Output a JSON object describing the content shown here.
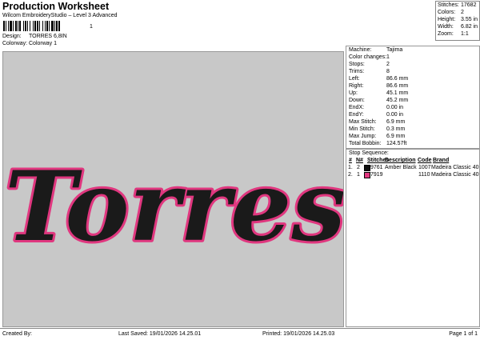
{
  "header": {
    "title": "Production Worksheet",
    "subtitle": "Wilcom EmbroideryStudio – Level 3 Advanced",
    "barcode_num": "1"
  },
  "meta": [
    {
      "key": "Design:",
      "value": "TORRES 6,8IN"
    },
    {
      "key": "Colorway:",
      "value": "Colorway 1"
    }
  ],
  "stats": [
    {
      "key": "Stitches:",
      "value": "17682"
    },
    {
      "key": "Colors:",
      "value": "2"
    },
    {
      "key": "Height:",
      "value": "3.55 in"
    },
    {
      "key": "Width:",
      "value": "6.82 in"
    },
    {
      "key": "Zoom:",
      "value": "1:1"
    }
  ],
  "design": {
    "text": "Torres",
    "fill_color": "#1a1a1a",
    "outline_color": "#e0377f",
    "background": "#c8c8c8"
  },
  "machine": [
    {
      "key": "Machine:",
      "value": "Tajima"
    },
    {
      "key": "Color changes:",
      "value": "1"
    },
    {
      "key": "Stops:",
      "value": "2"
    },
    {
      "key": "Trims:",
      "value": "8"
    },
    {
      "key": "Left:",
      "value": "86.6 mm"
    },
    {
      "key": "Right:",
      "value": "86.6 mm"
    },
    {
      "key": "Up:",
      "value": "45.1 mm"
    },
    {
      "key": "Down:",
      "value": "45.2 mm"
    },
    {
      "key": "EndX:",
      "value": "0.00 in"
    },
    {
      "key": "EndY:",
      "value": "0.00 in"
    },
    {
      "key": "Max Stitch:",
      "value": "6.9 mm"
    },
    {
      "key": "Min Stitch:",
      "value": "0.3 mm"
    },
    {
      "key": "Max Jump:",
      "value": "6.9 mm"
    },
    {
      "key": "Total Bobbin:",
      "value": "124.57ft"
    }
  ],
  "stop_sequence": {
    "title": "Stop Sequence:",
    "headers": [
      "#",
      "N#",
      "Stitches",
      "Description",
      "Code",
      "Brand"
    ],
    "rows": [
      {
        "idx": "1.",
        "n": "2",
        "swatch": "#111111",
        "stitches": "9761",
        "description": "Amber Black",
        "code": "1007",
        "brand": "Madeira Classic 40"
      },
      {
        "idx": "2.",
        "n": "1",
        "swatch": "#e0377f",
        "stitches": "7919",
        "description": "",
        "code": "1110",
        "brand": "Madeira Classic 40"
      }
    ]
  },
  "footer": {
    "created_by": "Created By:",
    "last_saved": "Last Saved: 19/01/2026 14.25.01",
    "printed": "Printed: 19/01/2026 14.25.03",
    "page": "Page 1 of 1"
  }
}
